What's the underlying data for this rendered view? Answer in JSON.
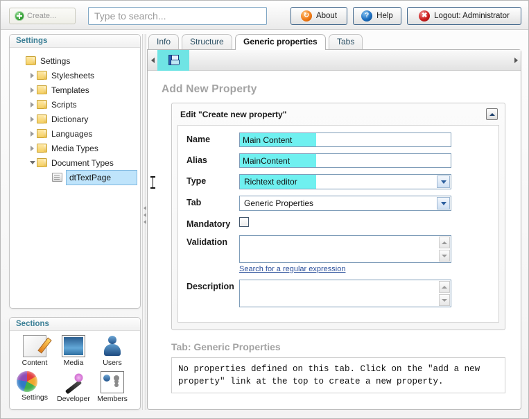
{
  "topbar": {
    "create_label": "Create...",
    "search_placeholder": "Type to search...",
    "search_value": "",
    "about_label": "About",
    "help_label": "Help",
    "logout_label": "Logout: Administrator"
  },
  "tree_panel": {
    "header": "Settings",
    "items": [
      {
        "label": "Settings",
        "level": 0,
        "twisty": "none",
        "icon": "folder-icon",
        "selected": false
      },
      {
        "label": "Stylesheets",
        "level": 1,
        "twisty": "collapsed",
        "icon": "folder-icon",
        "selected": false
      },
      {
        "label": "Templates",
        "level": 1,
        "twisty": "collapsed",
        "icon": "folder-icon",
        "selected": false
      },
      {
        "label": "Scripts",
        "level": 1,
        "twisty": "collapsed",
        "icon": "folder-icon",
        "selected": false
      },
      {
        "label": "Dictionary",
        "level": 1,
        "twisty": "collapsed",
        "icon": "folder-icon",
        "selected": false
      },
      {
        "label": "Languages",
        "level": 1,
        "twisty": "collapsed",
        "icon": "folder-icon",
        "selected": false
      },
      {
        "label": "Media Types",
        "level": 1,
        "twisty": "collapsed",
        "icon": "folder-icon",
        "selected": false
      },
      {
        "label": "Document Types",
        "level": 1,
        "twisty": "expanded",
        "icon": "folder-icon",
        "selected": false
      },
      {
        "label": "dtTextPage",
        "level": 2,
        "twisty": "none",
        "icon": "document-type-icon",
        "selected": true
      }
    ]
  },
  "sections_panel": {
    "header": "Sections",
    "items": [
      {
        "label": "Content",
        "icon": "content-icon"
      },
      {
        "label": "Media",
        "icon": "media-icon"
      },
      {
        "label": "Users",
        "icon": "users-icon"
      },
      {
        "label": "Settings",
        "icon": "settings-icon"
      },
      {
        "label": "Developer",
        "icon": "developer-icon"
      },
      {
        "label": "Members",
        "icon": "members-icon"
      }
    ]
  },
  "main": {
    "tabs": [
      {
        "label": "Info",
        "active": false
      },
      {
        "label": "Structure",
        "active": false
      },
      {
        "label": "Generic properties",
        "active": true
      },
      {
        "label": "Tabs",
        "active": false
      }
    ],
    "toolbar": {
      "save_icon": "save-floppy-icon"
    },
    "page_title": "Add New Property",
    "edit_box": {
      "title": "Edit \"Create new property\"",
      "fields": [
        {
          "label": "Name",
          "kind": "text",
          "value": "Main Content",
          "highlight": true
        },
        {
          "label": "Alias",
          "kind": "text",
          "value": "MainContent",
          "highlight": true
        },
        {
          "label": "Type",
          "kind": "select",
          "value": "Richtext editor",
          "highlight": true
        },
        {
          "label": "Tab",
          "kind": "select",
          "value": "Generic Properties",
          "highlight": false
        },
        {
          "label": "Mandatory",
          "kind": "checkbox",
          "value": "",
          "checked": false
        },
        {
          "label": "Validation",
          "kind": "textarea",
          "value": ""
        },
        {
          "label": "Description",
          "kind": "textarea",
          "value": ""
        }
      ],
      "regex_link": "Search for a regular expression"
    },
    "tab_section_title": "Tab: Generic Properties",
    "tab_section_note": "No properties defined on this tab. Click on the \"add a new property\" link at the top to create a new property."
  },
  "colors": {
    "highlight_cyan": "#6ff0f0",
    "selection_blue": "#bfe4fb",
    "panel_header_text": "#3b7f96",
    "heading_gray": "#a3a3a3",
    "link_blue": "#2a4f9b"
  }
}
